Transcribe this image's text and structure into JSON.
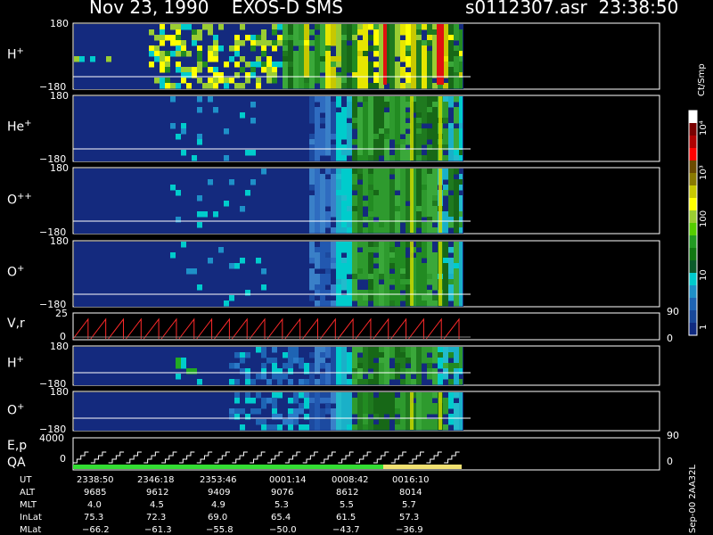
{
  "header": {
    "title": "Nov 23, 1990    EXOS-D SMS",
    "file_time": "s0112307.asr  23:38:50"
  },
  "colorbar": {
    "unit": "Ct/Smp",
    "tick_labels": [
      "10⁴",
      "10³",
      "100",
      "10",
      "1"
    ],
    "colors": [
      "#ffffff",
      "#7a0000",
      "#b00000",
      "#ff0000",
      "#6b4a00",
      "#8a7a00",
      "#c8c800",
      "#ffff00",
      "#9acd32",
      "#55cc00",
      "#229922",
      "#117711",
      "#0a5a2a",
      "#00cccc",
      "#1e90c8",
      "#1e64b4",
      "#18489a",
      "#102a80"
    ]
  },
  "panels": [
    {
      "species": "H",
      "charge": "+",
      "ymax": "180",
      "ymin": "−180"
    },
    {
      "species": "He",
      "charge": "+",
      "ymax": "180",
      "ymin": "−180"
    },
    {
      "species": "O",
      "charge": "++",
      "ymax": "180",
      "ymin": "−180"
    },
    {
      "species": "O",
      "charge": "+",
      "ymax": "180",
      "ymin": "−180"
    },
    {
      "species": "V,r",
      "charge": "",
      "ymax": "25",
      "ymin": "0",
      "right_max": "90",
      "right_min": "0"
    },
    {
      "species": "H",
      "charge": "+",
      "ymax": "180",
      "ymin": "−180"
    },
    {
      "species": "O",
      "charge": "+",
      "ymax": "180",
      "ymin": "−180"
    },
    {
      "species": "E,p",
      "species2": "QA",
      "charge": "",
      "ymax": "4000",
      "ymin": "0",
      "right_max": "90",
      "right_min": "0"
    }
  ],
  "footer_table": {
    "row_labels": [
      "UT",
      "ALT",
      "MLT",
      "InLat",
      "MLat"
    ],
    "columns": [
      [
        "2338:50",
        "9685",
        "4.0",
        "75.3",
        "−66.2"
      ],
      [
        "2346:18",
        "9612",
        "4.5",
        "72.3",
        "−61.3"
      ],
      [
        "2353:46",
        "9409",
        "4.9",
        "69.0",
        "−55.8"
      ],
      [
        "0001:14",
        "9076",
        "5.3",
        "65.4",
        "−50.0"
      ],
      [
        "0008:42",
        "8612",
        "5.5",
        "61.5",
        "−43.7"
      ],
      [
        "0016:10",
        "8014",
        "5.7",
        "57.3",
        "−36.9"
      ]
    ]
  },
  "plot_id": "Sep-00  2AA32L",
  "chart_data": {
    "type": "heatmap",
    "title": "Nov 23, 1990    EXOS-D SMS",
    "colorbar_label": "Ct/Smp",
    "colorbar_scale": "log",
    "colorbar_range": [
      1,
      10000
    ],
    "x_tick_labels": [
      "2338:50",
      "2346:18",
      "2353:46",
      "0001:14",
      "0008:42",
      "0016:10"
    ],
    "y_range_pitch_panels": [
      -180,
      180
    ],
    "panels": [
      "H+",
      "He+",
      "O++",
      "O+",
      "V,r",
      "H+",
      "O+",
      "E,p QA"
    ]
  }
}
